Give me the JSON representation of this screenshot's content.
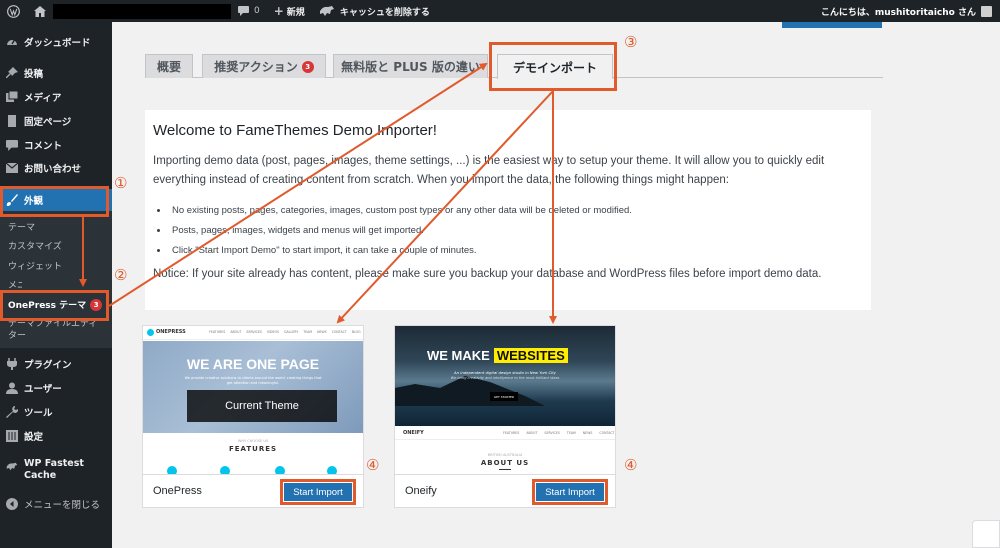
{
  "admin_bar": {
    "comment_count": "0",
    "new_label": "新規",
    "cache_label": "キャッシュを削除する",
    "greeting": "こんにちは、mushitoritaicho さん"
  },
  "sidebar": {
    "items": [
      {
        "label": "ダッシュボード"
      },
      {
        "label": "投稿"
      },
      {
        "label": "メディア"
      },
      {
        "label": "固定ページ"
      },
      {
        "label": "コメント"
      },
      {
        "label": "お問い合わせ"
      },
      {
        "label": "外観"
      },
      {
        "label": "プラグイン"
      },
      {
        "label": "ユーザー"
      },
      {
        "label": "ツール"
      },
      {
        "label": "設定"
      },
      {
        "label": "WP Fastest\nCache"
      },
      {
        "label": "メニューを閉じる"
      }
    ],
    "submenu": [
      {
        "label": "テーマ"
      },
      {
        "label": "カスタマイズ"
      },
      {
        "label": "ウィジェット"
      },
      {
        "label": "メニュー"
      },
      {
        "label": "OnePress テーマ",
        "badge": "3"
      },
      {
        "label": "テーマファイルエディター"
      }
    ]
  },
  "tabs": [
    {
      "label": "概要"
    },
    {
      "label": "推奨アクション",
      "badge": "3"
    },
    {
      "label": "無料版と PLUS 版の違い"
    },
    {
      "label": "デモインポート"
    }
  ],
  "panel": {
    "title": "Welcome to FameThemes Demo Importer!",
    "intro": "Importing demo data (post, pages, images, theme settings, ...) is the easiest way to setup your theme. It will allow you to quickly edit everything instead of creating content from scratch. When you import the data, the following things might happen:",
    "bullets": [
      "No existing posts, pages, categories, images, custom post types or any other data will be deleted or modified.",
      "Posts, pages, images, widgets and menus will get imported.",
      "Click \"Start Import Demo\" to start import, it can take a couple of minutes."
    ],
    "notice": "Notice: If your site already has content, please make sure you backup your database and WordPress files before import demo data."
  },
  "demos": [
    {
      "name": "OnePress",
      "button": "Start Import",
      "preview": {
        "brand": "ONEPRESS",
        "headline": "WE ARE ONE PAGE",
        "sub": "We provide creative solutions to clients around the world, creating things that get attention and meaningful.",
        "cta": "Current Theme",
        "section_kicker": "WHY CHOOSE US",
        "section": "FEATURES",
        "nav": [
          "FEATURES",
          "ABOUT",
          "SERVICES",
          "VIDEOS",
          "GALLERY",
          "TEAM",
          "NEWS",
          "CONTACT",
          "BLOG"
        ]
      }
    },
    {
      "name": "Oneify",
      "button": "Start Import",
      "preview": {
        "brand": "ONEIFY",
        "headline_a": "WE MAKE",
        "headline_b": "WEBSITES",
        "sub1": "An independent digital design studio in New York City",
        "sub2": "We bring creativity and intelligence to the most brilliant ideas",
        "cta": "GET STARTED",
        "section_kicker": "BRITISH AUSTRALIA",
        "section": "ABOUT US",
        "nav": [
          "FEATURES",
          "ABOUT",
          "SERVICES",
          "TEAM",
          "NEWS",
          "CONTACT"
        ]
      }
    }
  ],
  "annotations": [
    "①",
    "②",
    "③",
    "④",
    "④"
  ],
  "colors": {
    "annotation": "#e05a2b",
    "wp_blue": "#2271b1",
    "admin_dark": "#1d2327"
  }
}
